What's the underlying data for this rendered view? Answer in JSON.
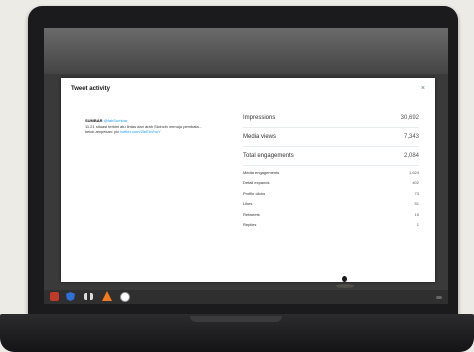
{
  "modal": {
    "title": "Tweet activity",
    "close": "×"
  },
  "tweet": {
    "author": "SUMBAR",
    "handle": "@fabSumbar",
    "text": "11.21 situasi terkini atu lintas dari arah Sicincin menuju pembata...",
    "text2": "kelok ampekan: pic",
    "link": "twitter.com/ZleEkVnuY"
  },
  "stats": {
    "main": [
      {
        "label": "Impressions",
        "value": "30,692"
      },
      {
        "label": "Media views",
        "value": "7,343"
      },
      {
        "label": "Total engagements",
        "value": "2,084"
      }
    ],
    "breakdown": [
      {
        "label": "Media engagements",
        "value": "1,624"
      },
      {
        "label": "Detail expands",
        "value": "402"
      },
      {
        "label": "Profile clicks",
        "value": "73"
      },
      {
        "label": "Likes",
        "value": "51"
      },
      {
        "label": "Retweets",
        "value": "15"
      },
      {
        "label": "Replies",
        "value": "1"
      }
    ]
  },
  "taskbar": {
    "icons": [
      "start-icon",
      "shield-icon",
      "network-icon",
      "vlc-icon",
      "itunes-icon",
      "tray-icon"
    ]
  }
}
